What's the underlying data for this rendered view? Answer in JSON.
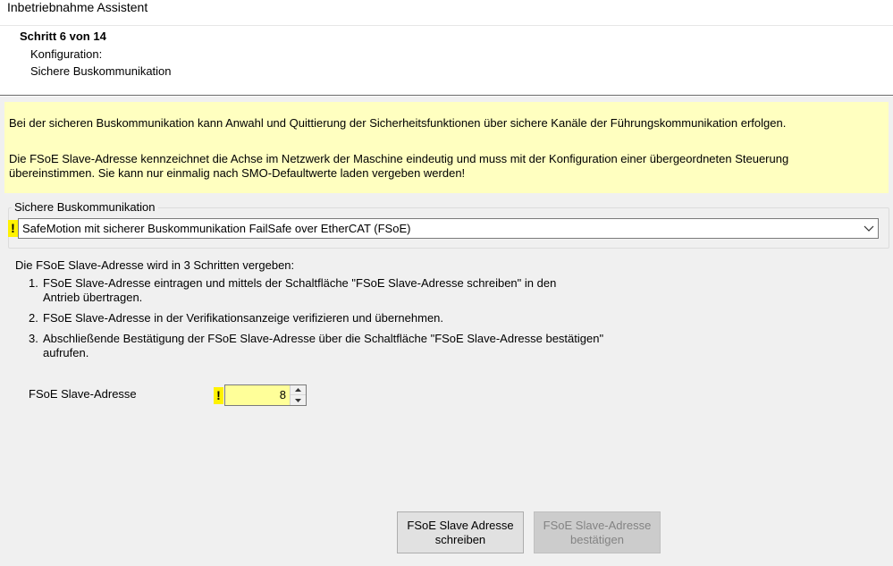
{
  "window": {
    "title": "Inbetriebnahme Assistent"
  },
  "header": {
    "step_title": "Schritt 6 von 14",
    "subtitle_line1": "Konfiguration:",
    "subtitle_line2": "Sichere Buskommunikation"
  },
  "info": {
    "paragraph1": "Bei der sicheren Buskommunikation kann Anwahl und Quittierung der Sicherheitsfunktionen über sichere Kanäle der Führungskommunikation erfolgen.",
    "paragraph2": "Die FSoE Slave-Adresse kennzeichnet die Achse im Netzwerk der Maschine eindeutig und muss mit der Konfiguration einer übergeordneten Steuerung übereinstimmen. Sie kann nur einmalig nach SMO-Defaultwerte laden vergeben werden!",
    "background_color": "#ffffc0"
  },
  "bus_group": {
    "legend": "Sichere Buskommunikation",
    "warning_symbol": "!",
    "selected_value": "SafeMotion mit sicherer Buskommunikation FailSafe over EtherCAT (FSoE)"
  },
  "instructions": {
    "intro": "Die FSoE Slave-Adresse wird in 3 Schritten vergeben:",
    "steps": [
      {
        "num": "1.",
        "line1": "FSoE Slave-Adresse eintragen und mittels der Schaltfläche \"FSoE Slave-Adresse schreiben\" in den",
        "line2": "Antrieb übertragen."
      },
      {
        "num": "2.",
        "line1": "FSoE Slave-Adresse in der Verifikationsanzeige verifizieren und übernehmen."
      },
      {
        "num": "3.",
        "line1": "Abschließende Bestätigung der FSoE Slave-Adresse über die Schaltfläche \"FSoE Slave-Adresse bestätigen\"",
        "line2": "aufrufen."
      }
    ]
  },
  "address": {
    "label": "FSoE Slave-Adresse",
    "warning_symbol": "!",
    "value": "8",
    "field_color": "#ffff99",
    "warning_color": "#fff200"
  },
  "buttons": {
    "write_line1": "FSoE Slave Adresse",
    "write_line2": "schreiben",
    "confirm_line1": "FSoE Slave-Adresse",
    "confirm_line2": "bestätigen",
    "confirm_disabled": true
  }
}
